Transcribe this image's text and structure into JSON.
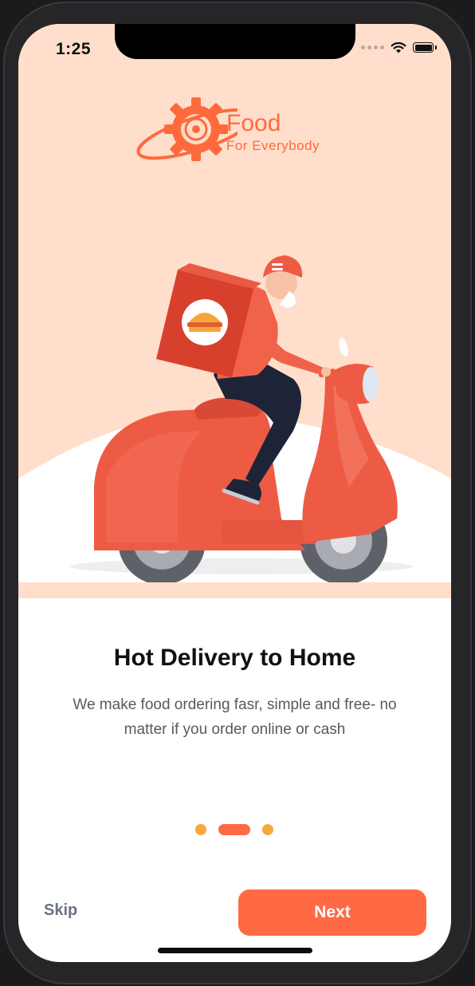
{
  "status_bar": {
    "time": "1:25",
    "icons": [
      "signal-dots-icon",
      "wifi-icon",
      "battery-icon"
    ]
  },
  "logo": {
    "name": "Food",
    "tagline": "For Everybody",
    "icon": "gear-planet-plate-icon"
  },
  "onboarding": {
    "title": "Hot Delivery to Home",
    "description": "We make food ordering fasr, simple and free- no matter if you order online or cash",
    "illustration": "delivery-scooter-rider-illustration",
    "page_index": 1,
    "page_count": 3
  },
  "actions": {
    "skip_label": "Skip",
    "next_label": "Next"
  },
  "colors": {
    "accent": "#ff6a45",
    "accent_dot": "#f7a83a",
    "hero_background": "#ffdfcb",
    "title_text": "#111111",
    "body_text": "#555a61"
  }
}
